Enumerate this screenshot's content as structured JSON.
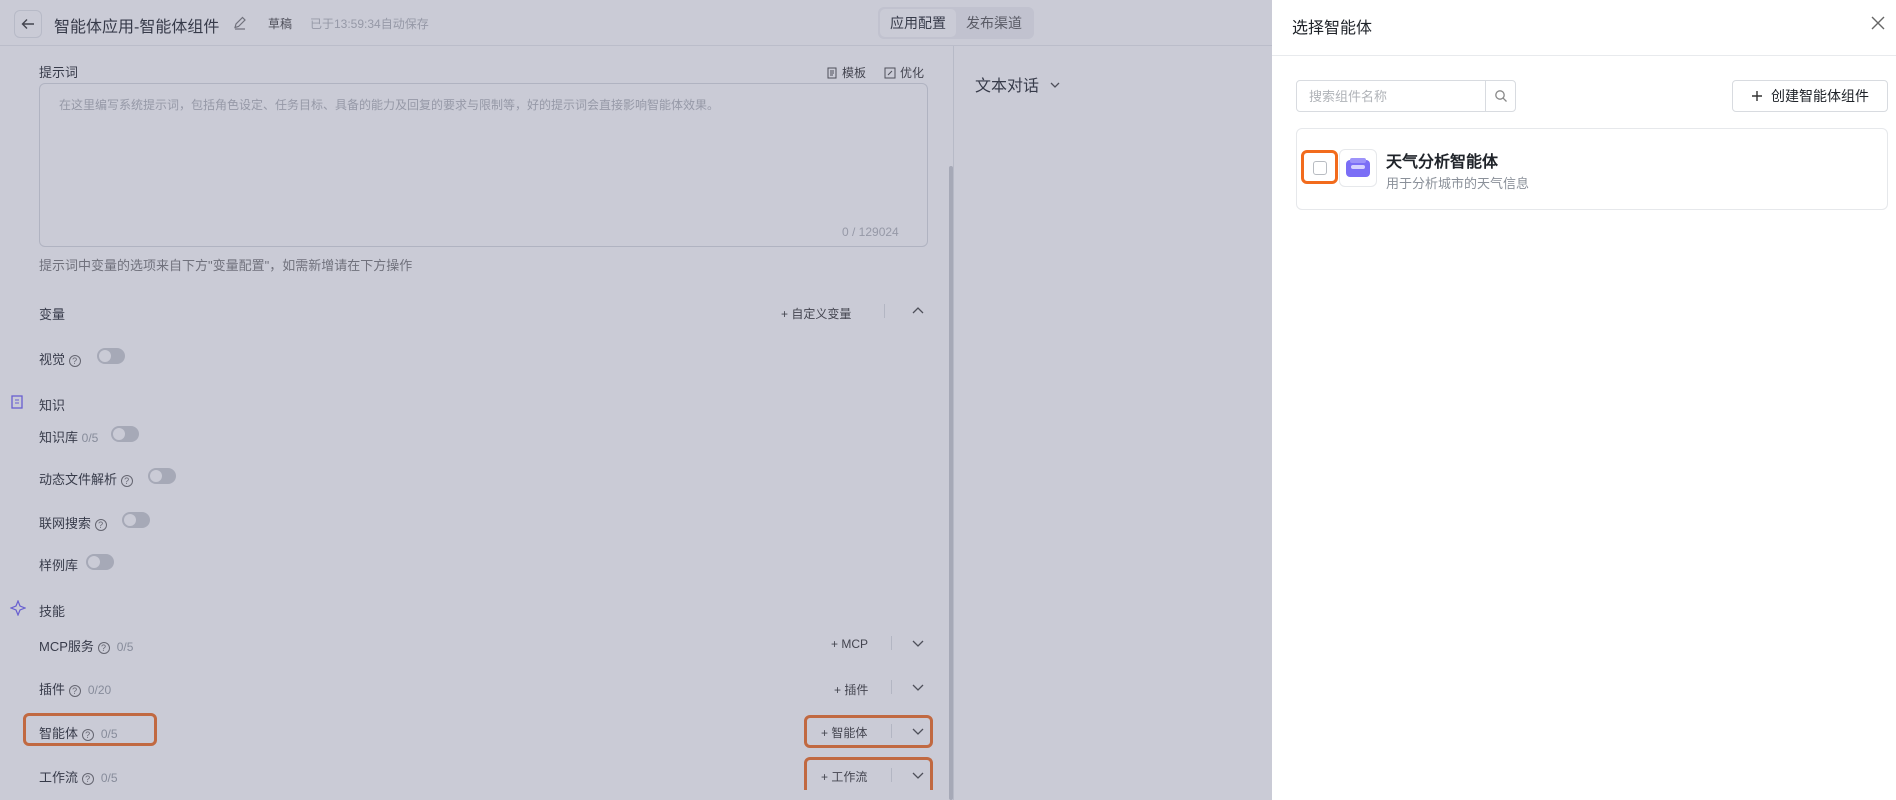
{
  "header": {
    "app_title": "智能体应用-智能体组件",
    "status_draft": "草稿",
    "saved_text": "已于13:59:34自动保存",
    "tabs": [
      {
        "label": "应用配置",
        "active": true
      },
      {
        "label": "发布渠道",
        "active": false
      }
    ]
  },
  "prompt": {
    "label": "提示词",
    "template_label": "模板",
    "optimize_label": "优化",
    "placeholder": "在这里编写系统提示词，包括角色设定、任务目标、具备的能力及回复的要求与限制等，好的提示词会直接影响智能体效果。",
    "char_count": "0 / 129024",
    "hint": "提示词中变量的选项来自下方\"变量配置\"，如需新增请在下方操作"
  },
  "variables": {
    "label": "变量",
    "custom_variable_label": "自定义变量"
  },
  "vision": {
    "label": "视觉"
  },
  "knowledge": {
    "section_label": "知识",
    "knowledge_base_label": "知识库",
    "knowledge_base_count": "0/5",
    "dynamic_file_label": "动态文件解析",
    "web_search_label": "联网搜索",
    "examples_label": "样例库"
  },
  "skills": {
    "section_label": "技能",
    "items": [
      {
        "label": "MCP服务",
        "count": "0/5",
        "action": "MCP"
      },
      {
        "label": "插件",
        "count": "0/20",
        "action": "插件"
      },
      {
        "label": "智能体",
        "count": "0/5",
        "action": "智能体"
      },
      {
        "label": "工作流",
        "count": "0/5",
        "action": "工作流"
      }
    ]
  },
  "preview": {
    "mode_label": "文本对话"
  },
  "drawer": {
    "title": "选择智能体",
    "search_placeholder": "搜索组件名称",
    "create_button_label": "创建智能体组件",
    "agents": [
      {
        "name": "天气分析智能体",
        "description": "用于分析城市的天气信息",
        "checked": false
      }
    ]
  },
  "colors": {
    "highlight": "#f26b1d",
    "overlay": "rgba(100,104,135,0.34)",
    "accent": "#6b5cf6"
  }
}
